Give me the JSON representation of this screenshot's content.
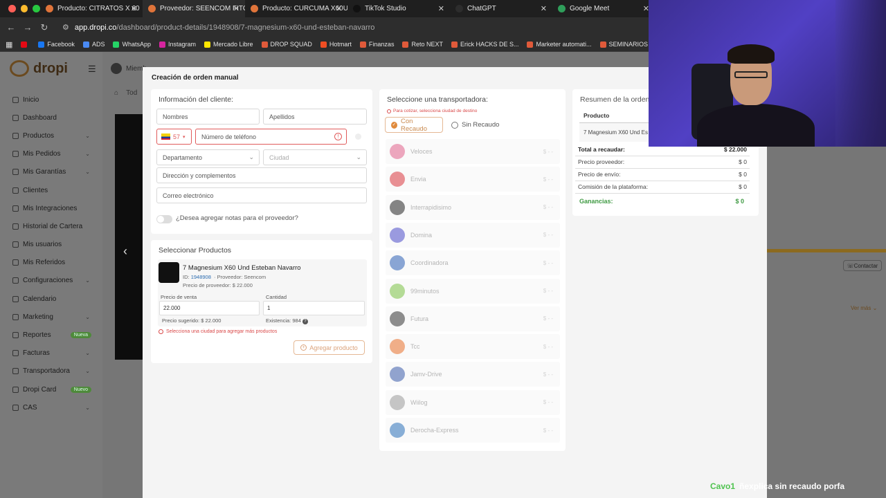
{
  "browser": {
    "tabs": [
      {
        "label": "Producto: CITRATOS X 60",
        "color": "#e0743a"
      },
      {
        "label": "Proveedor: SEENCOM FITO",
        "color": "#e0743a"
      },
      {
        "label": "Producto: CURCUMA X60U",
        "color": "#e0743a"
      },
      {
        "label": "TikTok Studio",
        "color": "#111111"
      },
      {
        "label": "ChatGPT",
        "color": "#2d2d2d"
      },
      {
        "label": "Google Meet",
        "color": "#2f9e5a"
      }
    ],
    "url_domain": "app.dropi.co",
    "url_path": "/dashboard/product-details/1948908/7-magnesium-x60-und-esteban-navarro",
    "bookmarks": [
      {
        "label": "",
        "color": "#e50914"
      },
      {
        "label": "Facebook",
        "color": "#1877f2"
      },
      {
        "label": "ADS",
        "color": "#4a8af4"
      },
      {
        "label": "WhatsApp",
        "color": "#25d366"
      },
      {
        "label": "Instagram",
        "color": "#d6249f"
      },
      {
        "label": "Mercado Libre",
        "color": "#ffe600"
      },
      {
        "label": "DROP SQUAD",
        "color": "#e05a3a"
      },
      {
        "label": "Hotmart",
        "color": "#f04e23"
      },
      {
        "label": "Finanzas",
        "color": "#e05a3a"
      },
      {
        "label": "Reto NEXT",
        "color": "#e05a3a"
      },
      {
        "label": "Erick HACKS DE S...",
        "color": "#e05a3a"
      },
      {
        "label": "Marketer automati...",
        "color": "#e05a3a"
      },
      {
        "label": "SEMINARIOS ONLI...",
        "color": "#e05a3a"
      }
    ]
  },
  "app": {
    "logo_text": "dropi",
    "topbar_text": "Miemb",
    "breadcrumb": "Tod",
    "contact_label": "Contactar",
    "ver_mas": "Ver más",
    "sidebar": [
      {
        "label": "Inicio",
        "chevron": false,
        "badge": ""
      },
      {
        "label": "Dashboard",
        "chevron": false,
        "badge": ""
      },
      {
        "label": "Productos",
        "chevron": true,
        "badge": ""
      },
      {
        "label": "Mis Pedidos",
        "chevron": true,
        "badge": ""
      },
      {
        "label": "Mis Garantías",
        "chevron": true,
        "badge": ""
      },
      {
        "label": "Clientes",
        "chevron": false,
        "badge": ""
      },
      {
        "label": "Mis Integraciones",
        "chevron": false,
        "badge": ""
      },
      {
        "label": "Historial de Cartera",
        "chevron": false,
        "badge": ""
      },
      {
        "label": "Mis usuarios",
        "chevron": false,
        "badge": ""
      },
      {
        "label": "Mis Referidos",
        "chevron": false,
        "badge": ""
      },
      {
        "label": "Configuraciones",
        "chevron": true,
        "badge": ""
      },
      {
        "label": "Calendario",
        "chevron": false,
        "badge": ""
      },
      {
        "label": "Marketing",
        "chevron": true,
        "badge": ""
      },
      {
        "label": "Reportes",
        "chevron": false,
        "badge": "Nueva"
      },
      {
        "label": "Facturas",
        "chevron": true,
        "badge": ""
      },
      {
        "label": "Transportadora",
        "chevron": true,
        "badge": ""
      },
      {
        "label": "Dropi Card",
        "chevron": false,
        "badge": "Nuevo"
      },
      {
        "label": "CAS",
        "chevron": true,
        "badge": ""
      }
    ]
  },
  "modal": {
    "title": "Creación de orden manual",
    "client": {
      "title": "Información del cliente:",
      "nombres_placeholder": "Nombres",
      "apellidos_placeholder": "Apellidos",
      "phone_code": "57",
      "phone_placeholder": "Número de teléfono",
      "departamento": "Departamento",
      "ciudad": "Ciudad",
      "direccion_placeholder": "Dirección y complementos",
      "correo_placeholder": "Correo electrónico",
      "notes_question": "¿Desea agregar notas para el proveedor?"
    },
    "products": {
      "title": "Seleccionar Productos",
      "name": "7 Magnesium X60 Und Esteban Navarro",
      "id_label": "ID:",
      "id_value": "1948908",
      "supplier": "Proveedor: Seencom",
      "supplier_price": "Precio de proveedor: $ 22.000",
      "sale_price_label": "Precio de venta",
      "sale_price_value": "22.000",
      "quantity_label": "Cantidad",
      "quantity_value": "1",
      "suggested_price": "Precio sugerido: $ 22.000",
      "stock": "Existencia: 984",
      "warning": "Selecciona una ciudad para agregar más productos",
      "add_button": "Agregar producto"
    },
    "carriers": {
      "title": "Seleccione una transportadora:",
      "hint": "Para cotizar, selecciona ciudad de destino",
      "with_collect": "Con Recaudo",
      "without_collect": "Sin Recaudo",
      "items": [
        {
          "name": "Veloces",
          "price": "$ - -",
          "color": "#e0608a"
        },
        {
          "name": "Envia",
          "price": "$ - -",
          "color": "#d9363e"
        },
        {
          "name": "Interrapidisimo",
          "price": "$ - -",
          "color": "#222222"
        },
        {
          "name": "Domina",
          "price": "$ - -",
          "color": "#4b4bc8"
        },
        {
          "name": "Coordinadora",
          "price": "$ - -",
          "color": "#2c5fb5"
        },
        {
          "name": "99minutos",
          "price": "$ - -",
          "color": "#7ac143"
        },
        {
          "name": "Futura",
          "price": "$ - -",
          "color": "#333333"
        },
        {
          "name": "Tcc",
          "price": "$ - -",
          "color": "#e8702a"
        },
        {
          "name": "Jamv-Drive",
          "price": "$ - -",
          "color": "#3b5ba9"
        },
        {
          "name": "Wiilog",
          "price": "$ - -",
          "color": "#999999"
        },
        {
          "name": "Derocha-Express",
          "price": "$ - -",
          "color": "#2a6fb8"
        }
      ]
    },
    "summary": {
      "title": "Resumen de la orden:",
      "col_product": "Producto",
      "product_name": "7 Magnesium X60 Und Es",
      "rows": [
        {
          "label": "Total a recaudar:",
          "value": "$ 22.000",
          "style": "bold"
        },
        {
          "label": "Precio proveedor:",
          "value": "$ 0",
          "style": ""
        },
        {
          "label": "Precio de envío:",
          "value": "$ 0",
          "style": ""
        },
        {
          "label": "Comisión de la plataforma:",
          "value": "$ 0",
          "style": ""
        },
        {
          "label": "Ganancias:",
          "value": "$ 0",
          "style": "green"
        }
      ]
    }
  },
  "caption": {
    "who": "Cavo1",
    "message": "ñexplica sin recaudo porfa"
  }
}
